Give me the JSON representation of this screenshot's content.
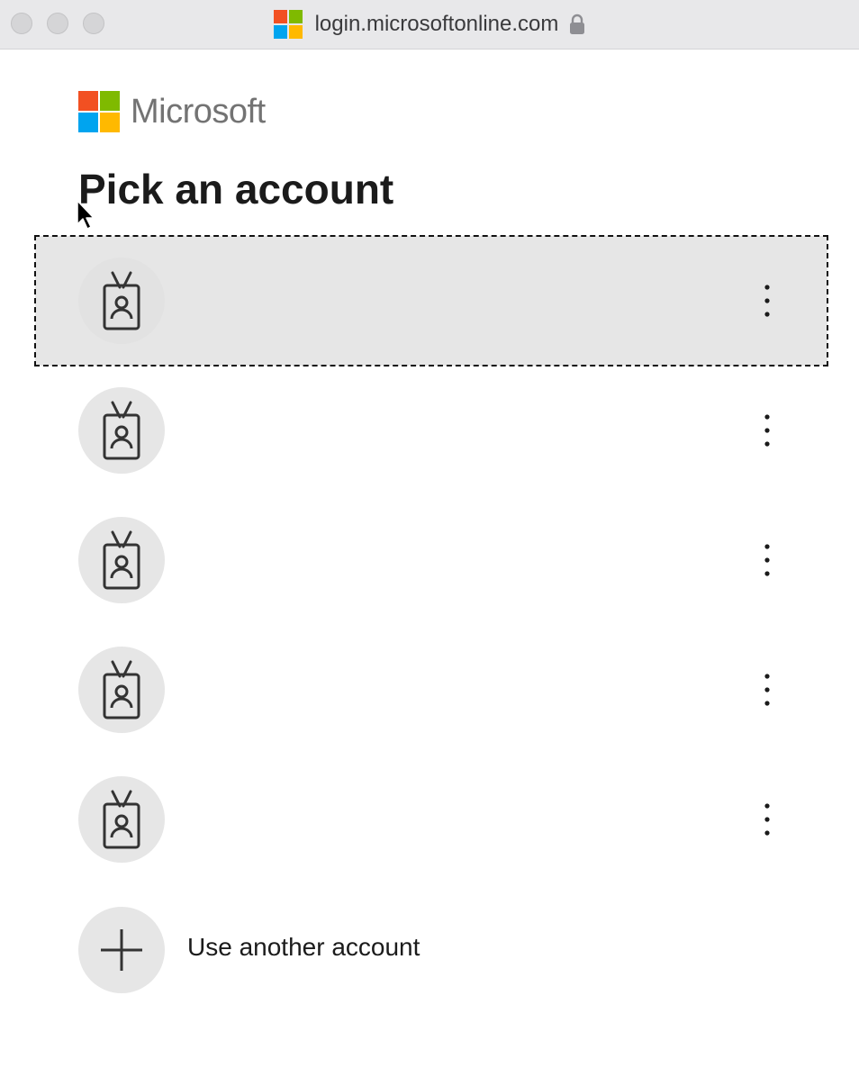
{
  "window": {
    "url": "login.microsoftonline.com",
    "favicon_colors": [
      "#f25022",
      "#7fba00",
      "#00a4ef",
      "#ffb900"
    ],
    "lock_icon": "lock-icon"
  },
  "brand": {
    "name": "Microsoft",
    "logo_colors": [
      "#f25022",
      "#7fba00",
      "#00a4ef",
      "#ffb900"
    ]
  },
  "page": {
    "title": "Pick an account"
  },
  "accounts": [
    {
      "email": "",
      "icon": "badge-icon",
      "focused": true
    },
    {
      "email": "",
      "icon": "badge-icon",
      "focused": false
    },
    {
      "email": "",
      "icon": "badge-icon",
      "focused": false
    },
    {
      "email": "",
      "icon": "badge-icon",
      "focused": false
    },
    {
      "email": "",
      "icon": "badge-icon",
      "focused": false
    }
  ],
  "add_account": {
    "label": "Use another account",
    "icon": "plus-icon"
  }
}
